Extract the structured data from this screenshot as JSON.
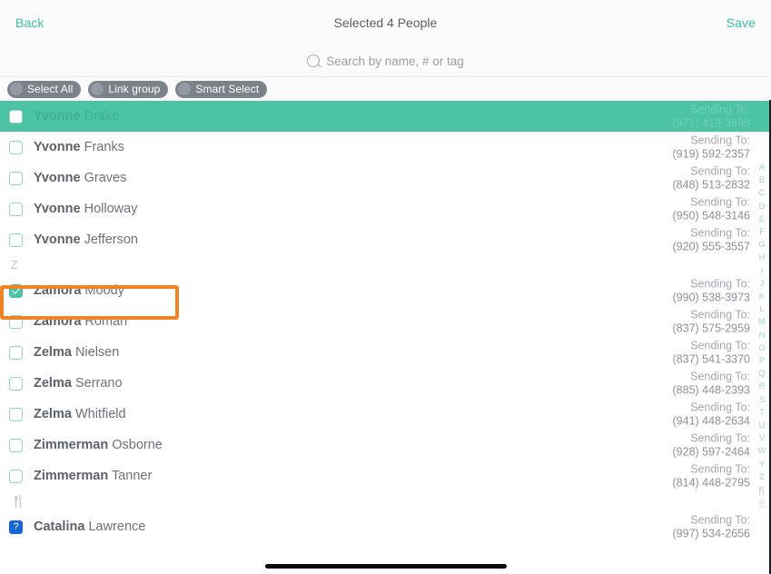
{
  "navbar": {
    "back_label": "Back",
    "title": "Selected 4 People",
    "save_label": "Save",
    "accent_color": "#3dbfa0"
  },
  "search": {
    "placeholder": "Search by name, # or tag",
    "icon": "search-icon"
  },
  "toolbar": {
    "pills": [
      {
        "label": "Select All",
        "on": false
      },
      {
        "label": "Link group",
        "on": false
      },
      {
        "label": "Smart Select",
        "on": false
      }
    ]
  },
  "theme": {
    "teal": "#4cc3a5",
    "selected_row_bg": "#4cc3a5",
    "focus_outline": "#f28322",
    "pill_bg": "#7c828c"
  },
  "sending_label": "Sending To:",
  "sections": {
    "z_letter": "Z",
    "emoji_letter": "🍴"
  },
  "list": [
    {
      "type": "contact",
      "first": "Yvonne",
      "last": "Drake",
      "checked": false,
      "highlighted": true,
      "section_letter": "Y",
      "sending_to": "Sending To:",
      "phone": "(971) 419-3698"
    },
    {
      "type": "contact",
      "first": "Yvonne",
      "last": "Franks",
      "checked": false,
      "highlighted": false,
      "sending_to": "Sending To:",
      "phone": "(919) 592-2357"
    },
    {
      "type": "contact",
      "first": "Yvonne",
      "last": "Graves",
      "checked": false,
      "highlighted": false,
      "sending_to": "Sending To:",
      "phone": "(848) 513-2832"
    },
    {
      "type": "contact",
      "first": "Yvonne",
      "last": "Holloway",
      "checked": false,
      "highlighted": false,
      "sending_to": "Sending To:",
      "phone": "(950) 548-3146"
    },
    {
      "type": "contact",
      "first": "Yvonne",
      "last": "Jefferson",
      "checked": false,
      "highlighted": false,
      "sending_to": "Sending To:",
      "phone": "(920) 555-3557"
    },
    {
      "type": "section",
      "label": "Z"
    },
    {
      "type": "contact",
      "first": "Zamora",
      "last": "Moody",
      "checked": true,
      "highlighted": false,
      "focused": true,
      "sending_to": "Sending To:",
      "phone": "(990) 538-3973"
    },
    {
      "type": "contact",
      "first": "Zamora",
      "last": "Roman",
      "checked": false,
      "highlighted": false,
      "sending_to": "Sending To:",
      "phone": "(837) 575-2959"
    },
    {
      "type": "contact",
      "first": "Zelma",
      "last": "Nielsen",
      "checked": false,
      "highlighted": false,
      "sending_to": "Sending To:",
      "phone": "(837) 541-3370"
    },
    {
      "type": "contact",
      "first": "Zelma",
      "last": "Serrano",
      "checked": false,
      "highlighted": false,
      "sending_to": "Sending To:",
      "phone": "(885) 448-2393"
    },
    {
      "type": "contact",
      "first": "Zelma",
      "last": "Whitfield",
      "checked": false,
      "highlighted": false,
      "sending_to": "Sending To:",
      "phone": "(941) 448-2634"
    },
    {
      "type": "contact",
      "first": "Zimmerman",
      "last": "Osborne",
      "checked": false,
      "highlighted": false,
      "sending_to": "Sending To:",
      "phone": "(928) 597-2464"
    },
    {
      "type": "contact",
      "first": "Zimmerman",
      "last": "Tanner",
      "checked": false,
      "highlighted": false,
      "sending_to": "Sending To:",
      "phone": "(814) 448-2795"
    },
    {
      "type": "section_emoji",
      "label": "🍴"
    },
    {
      "type": "contact_glyph",
      "glyph": "?",
      "first": "Catalina",
      "last": "Lawrence",
      "checked": false,
      "highlighted": false,
      "sending_to": "Sending To:",
      "phone": "(997) 534-2656"
    }
  ],
  "alpha_index": [
    "A",
    "B",
    "C",
    "D",
    "E",
    "F",
    "G",
    "H",
    "I",
    "J",
    "K",
    "L",
    "M",
    "N",
    "O",
    "P",
    "Q",
    "R",
    "S",
    "T",
    "U",
    "V",
    "W",
    "Y",
    "Z"
  ],
  "alpha_index_extra": [
    "🍴",
    "▒"
  ]
}
